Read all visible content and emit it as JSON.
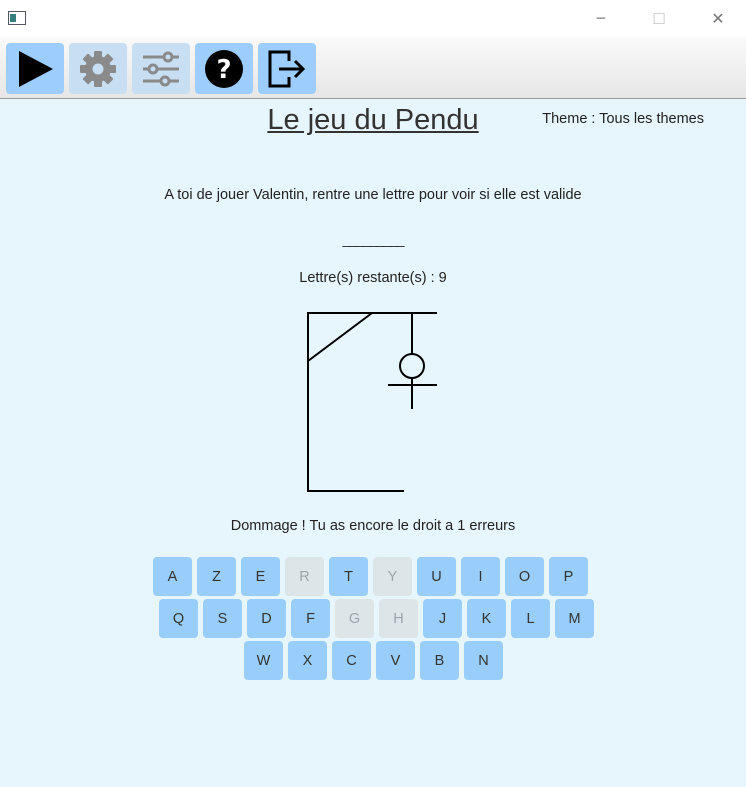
{
  "window": {
    "app_icon": "app-window-icon",
    "controls": {
      "minimize": "─",
      "maximize": "☐",
      "close": "✕"
    }
  },
  "toolbar": {
    "buttons": [
      {
        "name": "play",
        "icon": "play-icon"
      },
      {
        "name": "settings",
        "icon": "gear-icon"
      },
      {
        "name": "preferences",
        "icon": "sliders-icon"
      },
      {
        "name": "help",
        "icon": "help-icon"
      },
      {
        "name": "exit",
        "icon": "exit-icon"
      }
    ]
  },
  "game": {
    "title": "Le jeu du Pendu",
    "theme": "Theme : Tous les themes",
    "instructions": "A toi de jouer Valentin, rentre une lettre pour voir si elle est valide",
    "word_mask": "_________",
    "remaining": "Lettre(s) restante(s) : 9",
    "message": "Dommage ! Tu as encore le droit a 1 erreurs"
  },
  "keyboard": {
    "rows": [
      [
        {
          "letter": "A",
          "enabled": true
        },
        {
          "letter": "Z",
          "enabled": true
        },
        {
          "letter": "E",
          "enabled": true
        },
        {
          "letter": "R",
          "enabled": false
        },
        {
          "letter": "T",
          "enabled": true
        },
        {
          "letter": "Y",
          "enabled": false
        },
        {
          "letter": "U",
          "enabled": true
        },
        {
          "letter": "I",
          "enabled": true
        },
        {
          "letter": "O",
          "enabled": true
        },
        {
          "letter": "P",
          "enabled": true
        }
      ],
      [
        {
          "letter": "Q",
          "enabled": true
        },
        {
          "letter": "S",
          "enabled": true
        },
        {
          "letter": "D",
          "enabled": true
        },
        {
          "letter": "F",
          "enabled": true
        },
        {
          "letter": "G",
          "enabled": false
        },
        {
          "letter": "H",
          "enabled": false
        },
        {
          "letter": "J",
          "enabled": true
        },
        {
          "letter": "K",
          "enabled": true
        },
        {
          "letter": "L",
          "enabled": true
        },
        {
          "letter": "M",
          "enabled": true
        }
      ],
      [
        {
          "letter": "W",
          "enabled": true
        },
        {
          "letter": "X",
          "enabled": true
        },
        {
          "letter": "C",
          "enabled": true
        },
        {
          "letter": "V",
          "enabled": true
        },
        {
          "letter": "B",
          "enabled": true
        },
        {
          "letter": "N",
          "enabled": true
        }
      ]
    ]
  },
  "colors": {
    "background": "#e6f6fc",
    "key_enabled": "#99cefb",
    "key_disabled": "#dde5e9",
    "toolbar_active": "#9ccdfc",
    "toolbar_inactive": "#c8def3"
  }
}
